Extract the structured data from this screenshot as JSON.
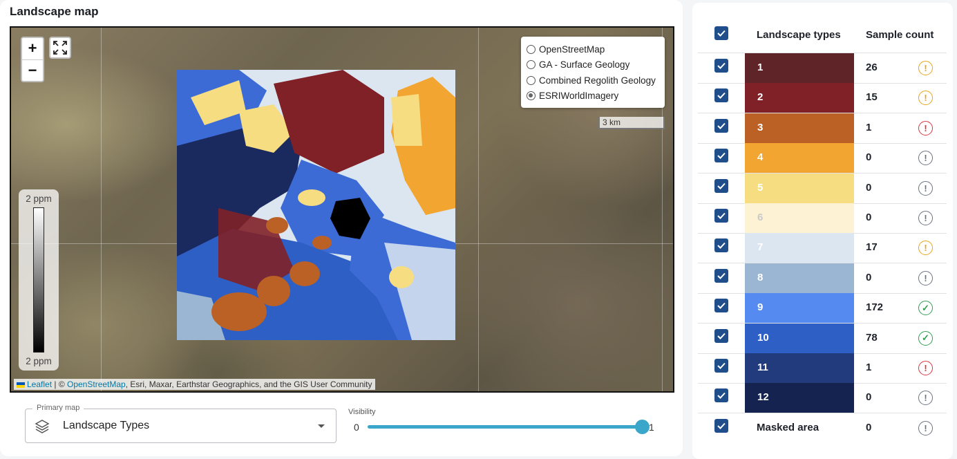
{
  "card_title": "Landscape map",
  "map": {
    "zoom_in": "+",
    "zoom_out": "−",
    "basemaps": [
      {
        "label": "OpenStreetMap",
        "selected": false
      },
      {
        "label": "GA - Surface Geology",
        "selected": false
      },
      {
        "label": "Combined Regolith Geology",
        "selected": false
      },
      {
        "label": "ESRIWorldImagery",
        "selected": true
      }
    ],
    "scale_label": "3 km",
    "gradient_legend": {
      "top": "2 ppm",
      "bottom": "2 ppm"
    },
    "attribution": {
      "leaflet": "Leaflet",
      "sep": " | © ",
      "osm": "OpenStreetMap",
      "rest": ", Esri, Maxar, Earthstar Geographics, and the GIS User Community"
    }
  },
  "primary_map": {
    "label": "Primary map",
    "value": "Landscape Types",
    "icon": "layers-icon"
  },
  "visibility": {
    "label": "Visibility",
    "min": "0",
    "max": "1",
    "value": 1.0
  },
  "table": {
    "header_type": "Landscape types",
    "header_count": "Sample count",
    "rows": [
      {
        "label": "1",
        "count": "26",
        "status": "warning",
        "color": "#5e2428",
        "text": "#ffffff"
      },
      {
        "label": "2",
        "count": "15",
        "status": "warning",
        "color": "#7f2127",
        "text": "#ffffff"
      },
      {
        "label": "3",
        "count": "1",
        "status": "error",
        "color": "#bc6126",
        "text": "#ffffff"
      },
      {
        "label": "4",
        "count": "0",
        "status": "neutral",
        "color": "#f2a530",
        "text": "#ffffff"
      },
      {
        "label": "5",
        "count": "0",
        "status": "neutral",
        "color": "#f7dd82",
        "text": "#ffffff"
      },
      {
        "label": "6",
        "count": "0",
        "status": "neutral",
        "color": "#fdf2d3",
        "text": "#c9c9c9"
      },
      {
        "label": "7",
        "count": "17",
        "status": "warning",
        "color": "#dce6f1",
        "text": "#ffffff"
      },
      {
        "label": "8",
        "count": "0",
        "status": "neutral",
        "color": "#9ab6d3",
        "text": "#ffffff"
      },
      {
        "label": "9",
        "count": "172",
        "status": "ok",
        "color": "#558af0",
        "text": "#ffffff"
      },
      {
        "label": "10",
        "count": "78",
        "status": "ok",
        "color": "#2d5fc4",
        "text": "#ffffff"
      },
      {
        "label": "11",
        "count": "1",
        "status": "error",
        "color": "#223b7d",
        "text": "#ffffff"
      },
      {
        "label": "12",
        "count": "0",
        "status": "neutral",
        "color": "#142350",
        "text": "#ffffff"
      }
    ],
    "masked": {
      "label": "Masked area",
      "count": "0",
      "status": "neutral"
    }
  },
  "status_colors": {
    "warning": "#e8a317",
    "error": "#d9363e",
    "neutral": "#6b7280",
    "ok": "#2e9e4f"
  },
  "checkbox_color": "#1f4e8a"
}
